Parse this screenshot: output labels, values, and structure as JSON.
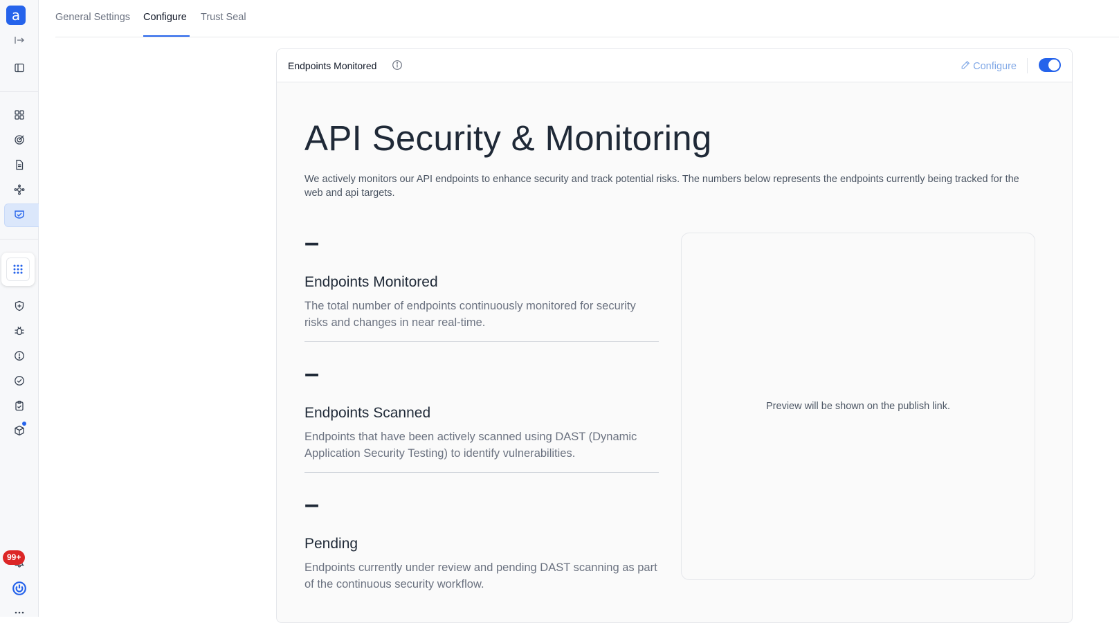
{
  "sidebar": {
    "logo_letter": "a",
    "notification_count": "99+",
    "icons": [
      "expand-icon",
      "panel-icon",
      "dashboard-icon",
      "target-icon",
      "document-icon",
      "integrations-icon",
      "trust-shield-icon",
      "apps-grid-icon",
      "shield-icon",
      "bug-icon",
      "alert-icon",
      "check-circle-icon",
      "clipboard-icon",
      "package-icon",
      "bell-icon",
      "power-icon",
      "more-icon"
    ]
  },
  "tabs": [
    {
      "label": "General Settings"
    },
    {
      "label": "Configure"
    },
    {
      "label": "Trust Seal"
    }
  ],
  "active_tab": "Configure",
  "card": {
    "header_title": "Endpoints Monitored",
    "configure_label": "Configure",
    "toggle_on": true
  },
  "main": {
    "title": "API Security & Monitoring",
    "description": "We actively monitors our API endpoints to enhance security and track potential risks. The numbers below represents the endpoints currently being tracked for the web and api targets.",
    "metrics": [
      {
        "value": "–",
        "name": "Endpoints Monitored",
        "description": "The total number of endpoints continuously monitored for security risks and changes in near real-time."
      },
      {
        "value": "–",
        "name": "Endpoints Scanned",
        "description": "Endpoints that have been actively scanned using DAST (Dynamic Application Security Testing) to identify vulnerabilities."
      },
      {
        "value": "–",
        "name": "Pending",
        "description": "Endpoints currently under review and pending DAST scanning as part of the continuous security workflow."
      }
    ],
    "preview_text": "Preview will be shown on the publish link."
  },
  "colors": {
    "accent": "#2563eb",
    "badge": "#dc2626",
    "configure_link": "#7fa7e6"
  }
}
